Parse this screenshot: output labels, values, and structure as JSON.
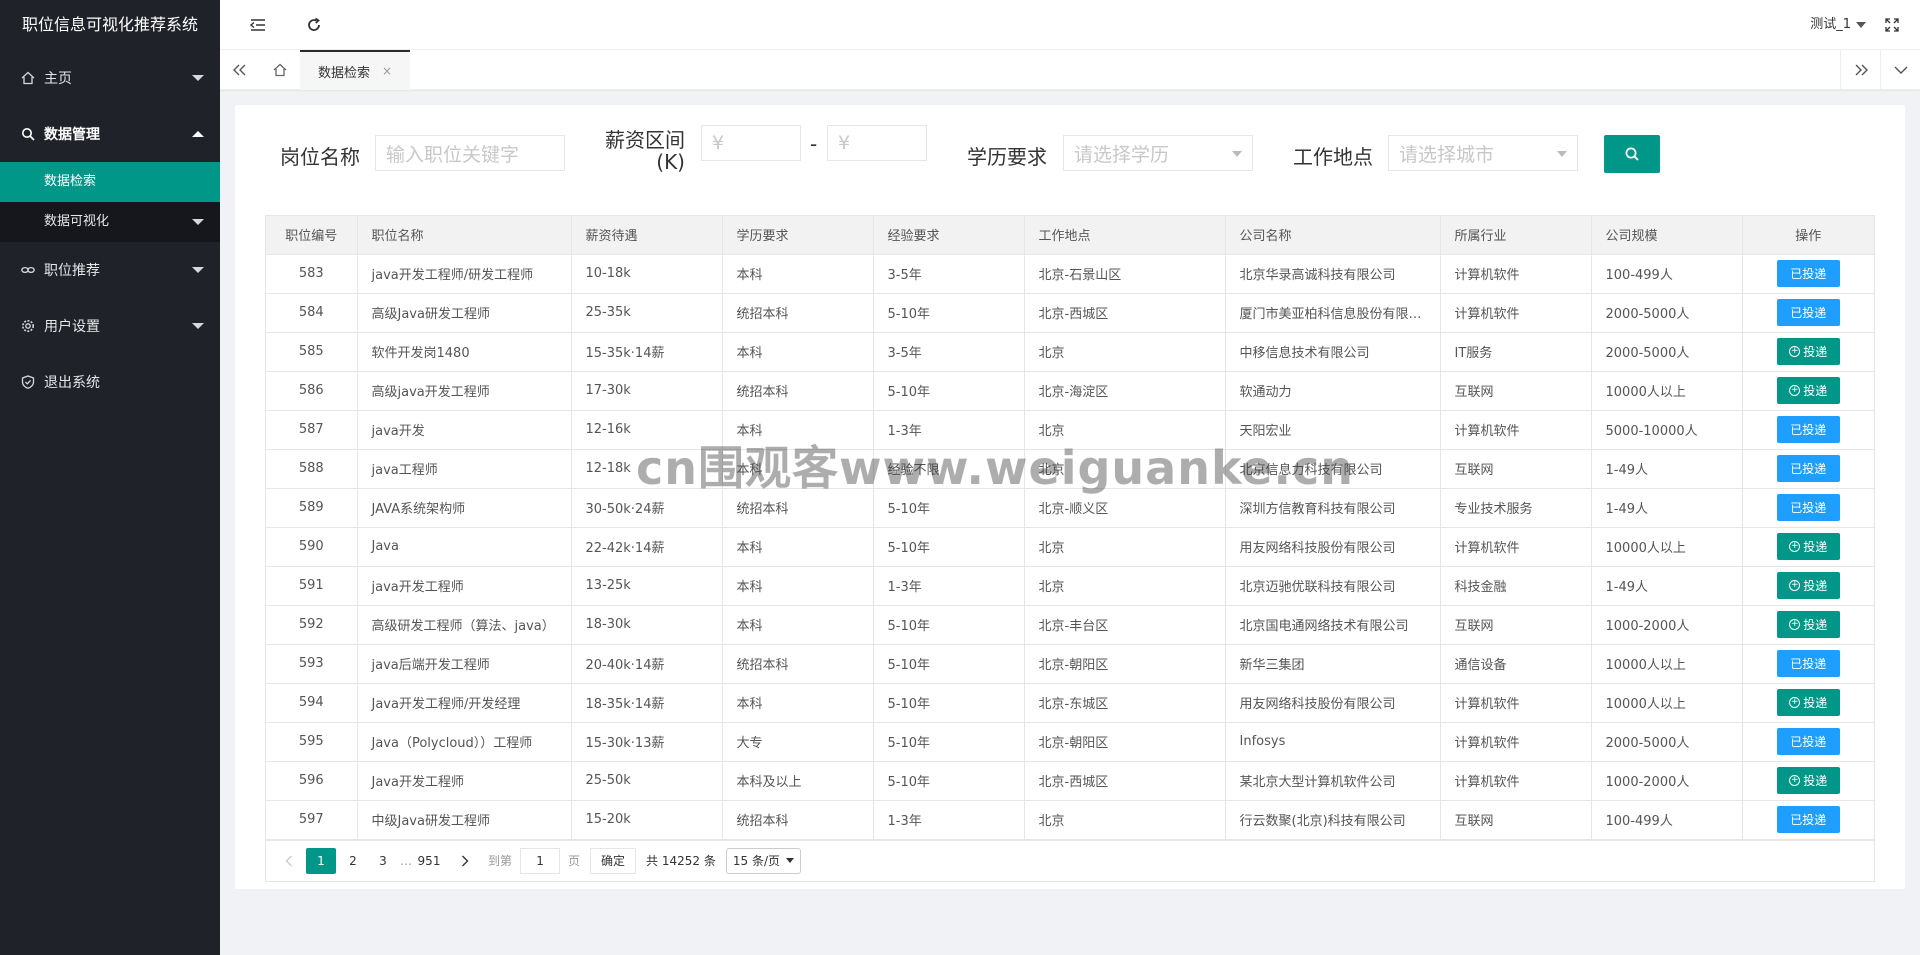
{
  "app_title": "职位信息可视化推荐系统",
  "sidebar": {
    "items": [
      {
        "label": "主页",
        "icon": "home-icon"
      },
      {
        "label": "数据管理",
        "icon": "search-icon",
        "open": true,
        "children": [
          {
            "label": "数据检索",
            "active": true
          },
          {
            "label": "数据可视化"
          }
        ]
      },
      {
        "label": "职位推荐",
        "icon": "link-icon"
      },
      {
        "label": "用户设置",
        "icon": "gear-icon"
      },
      {
        "label": "退出系统",
        "icon": "shield-icon"
      }
    ]
  },
  "header": {
    "user": "测试_1"
  },
  "tabs": [
    {
      "label": "数据检索",
      "close": "×"
    }
  ],
  "search": {
    "job_label": "岗位名称",
    "job_placeholder": "输入职位关键字",
    "salary_label": "薪资区间",
    "salary_unit": "(K)",
    "salary_min_placeholder": "¥",
    "salary_max_placeholder": "¥",
    "salary_sep": "-",
    "edu_label": "学历要求",
    "edu_placeholder": "请选择学历",
    "city_label": "工作地点",
    "city_placeholder": "请选择城市"
  },
  "table": {
    "headers": [
      "职位编号",
      "职位名称",
      "薪资待遇",
      "学历要求",
      "经验要求",
      "工作地点",
      "公司名称",
      "所属行业",
      "公司规模",
      "操作"
    ],
    "action_labels": {
      "done": "已投递",
      "apply": "投递"
    },
    "rows": [
      [
        "583",
        "java开发工程师/研发工程师",
        "10-18k",
        "本科",
        "3-5年",
        "北京-石景山区",
        "北京华录高诚科技有限公司",
        "计算机软件",
        "100-499人",
        "done"
      ],
      [
        "584",
        "高级Java研发工程师",
        "25-35k",
        "统招本科",
        "5-10年",
        "北京-西城区",
        "厦门市美亚柏科信息股份有限公司",
        "计算机软件",
        "2000-5000人",
        "done"
      ],
      [
        "585",
        "软件开发岗1480",
        "15-35k·14薪",
        "本科",
        "3-5年",
        "北京",
        "中移信息技术有限公司",
        "IT服务",
        "2000-5000人",
        "apply"
      ],
      [
        "586",
        "高级java开发工程师",
        "17-30k",
        "统招本科",
        "5-10年",
        "北京-海淀区",
        "软通动力",
        "互联网",
        "10000人以上",
        "apply"
      ],
      [
        "587",
        "java开发",
        "12-16k",
        "本科",
        "1-3年",
        "北京",
        "天阳宏业",
        "计算机软件",
        "5000-10000人",
        "done"
      ],
      [
        "588",
        "java工程师",
        "12-18k",
        "本科",
        "经验不限",
        "北京",
        "北京信息力科技有限公司",
        "互联网",
        "1-49人",
        "done"
      ],
      [
        "589",
        "JAVA系统架构师",
        "30-50k·24薪",
        "统招本科",
        "5-10年",
        "北京-顺义区",
        "深圳方信教育科技有限公司",
        "专业技术服务",
        "1-49人",
        "done"
      ],
      [
        "590",
        "Java",
        "22-42k·14薪",
        "本科",
        "5-10年",
        "北京",
        "用友网络科技股份有限公司",
        "计算机软件",
        "10000人以上",
        "apply"
      ],
      [
        "591",
        "java开发工程师",
        "13-25k",
        "本科",
        "1-3年",
        "北京",
        "北京迈驰优联科技有限公司",
        "科技金融",
        "1-49人",
        "apply"
      ],
      [
        "592",
        "高级研发工程师（算法、java）",
        "18-30k",
        "本科",
        "5-10年",
        "北京-丰台区",
        "北京国电通网络技术有限公司",
        "互联网",
        "1000-2000人",
        "apply"
      ],
      [
        "593",
        "java后端开发工程师",
        "20-40k·14薪",
        "统招本科",
        "5-10年",
        "北京-朝阳区",
        "新华三集团",
        "通信设备",
        "10000人以上",
        "done"
      ],
      [
        "594",
        "Java开发工程师/开发经理",
        "18-35k·14薪",
        "本科",
        "5-10年",
        "北京-东城区",
        "用友网络科技股份有限公司",
        "计算机软件",
        "10000人以上",
        "apply"
      ],
      [
        "595",
        "Java（Polycloud））工程师",
        "15-30k·13薪",
        "大专",
        "5-10年",
        "北京-朝阳区",
        "Infosys",
        "计算机软件",
        "2000-5000人",
        "done"
      ],
      [
        "596",
        "Java开发工程师",
        "25-50k",
        "本科及以上",
        "5-10年",
        "北京-西城区",
        "某北京大型计算机软件公司",
        "计算机软件",
        "1000-2000人",
        "apply"
      ],
      [
        "597",
        "中级Java研发工程师",
        "15-20k",
        "统招本科",
        "1-3年",
        "北京",
        "行云数聚(北京)科技有限公司",
        "互联网",
        "100-499人",
        "done"
      ]
    ]
  },
  "pager": {
    "pages": [
      "1",
      "2",
      "3",
      "…",
      "951"
    ],
    "goto_label": "到第",
    "goto_value": "1",
    "page_unit": "页",
    "ok_label": "确定",
    "total": "共 14252 条",
    "page_size": "15 条/页"
  },
  "watermark": "cn围观客www.weiguanke.cn",
  "colors": {
    "sidebar_bg": "#20222a",
    "accent": "#009688",
    "blue": "#1e9fff"
  }
}
